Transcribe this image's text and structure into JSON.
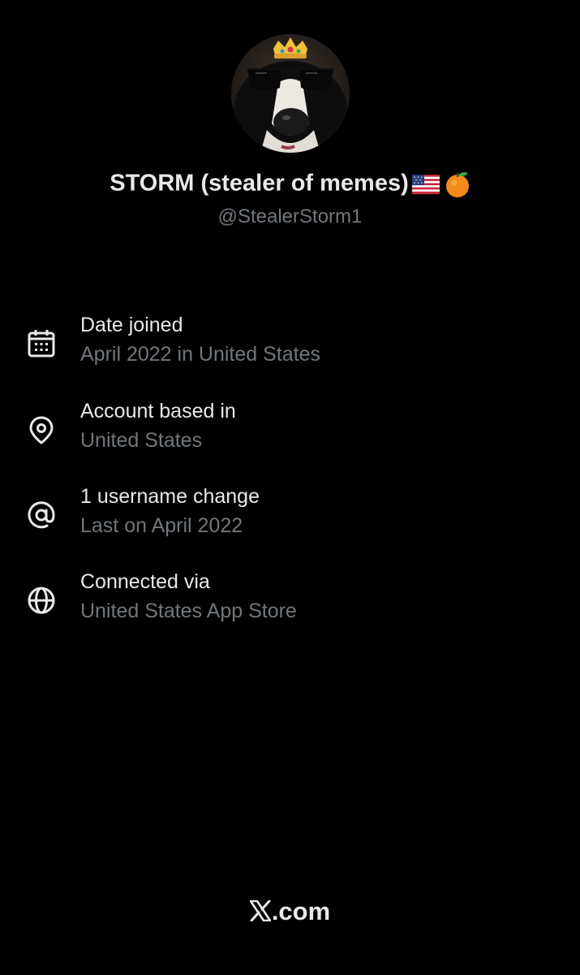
{
  "profile": {
    "display_name": "STORM (stealer of memes)",
    "name_emojis": [
      "us-flag-icon",
      "orange-icon"
    ],
    "handle": "@StealerStorm1",
    "avatar": "avatar-dog-with-sunglasses-and-crown"
  },
  "info": [
    {
      "icon": "calendar-icon",
      "title": "Date joined",
      "subtitle": "April 2022 in United States"
    },
    {
      "icon": "location-pin-icon",
      "title": "Account based in",
      "subtitle": "United States"
    },
    {
      "icon": "at-sign-icon",
      "title": "1 username change",
      "subtitle": "Last on April 2022"
    },
    {
      "icon": "globe-icon",
      "title": "Connected via",
      "subtitle": "United States App Store"
    }
  ],
  "footer": {
    "brand_label": ".com",
    "logo": "x-logo-icon"
  },
  "colors": {
    "background": "#000000",
    "primary_text": "#e7e9ea",
    "secondary_text": "#71767b"
  }
}
